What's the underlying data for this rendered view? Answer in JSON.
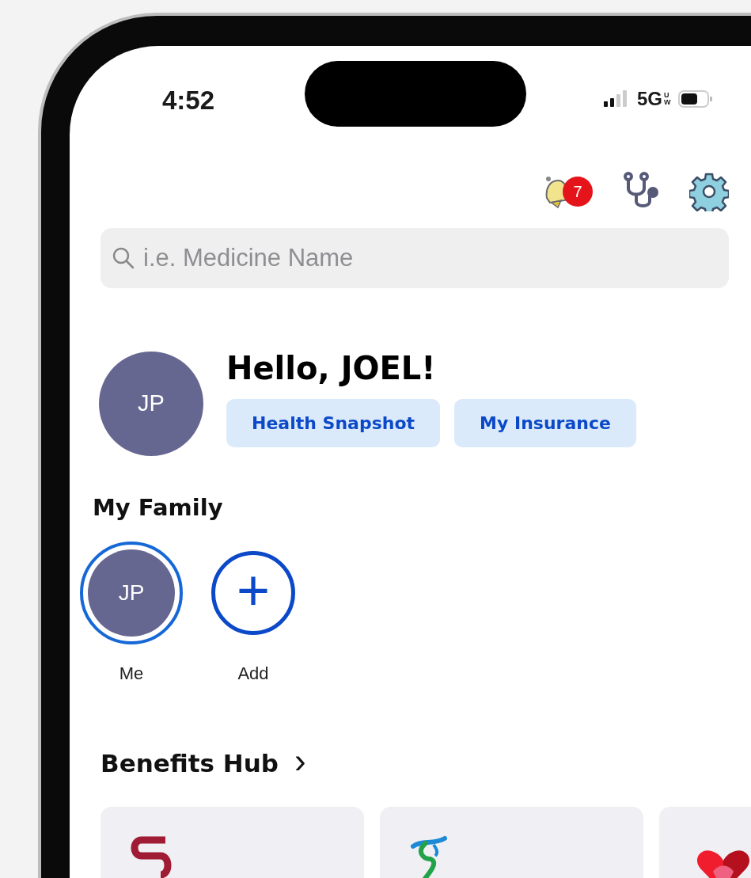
{
  "status_bar": {
    "time": "4:52",
    "network": "5G",
    "network_badge": "UW"
  },
  "header": {
    "notification_count": "7"
  },
  "search": {
    "placeholder": "i.e. Medicine Name"
  },
  "profile": {
    "initials": "JP",
    "greeting": "Hello, JOEL!"
  },
  "quick_buttons": [
    "Health Snapshot",
    "My Insurance"
  ],
  "family": {
    "title": "My Family",
    "members": [
      {
        "kind": "member",
        "initials": "JP",
        "label": "Me",
        "selected": true
      },
      {
        "kind": "add",
        "icon": "+",
        "label": "Add",
        "selected": false
      }
    ]
  },
  "benefits": {
    "title": "Benefits Hub",
    "chevron": "›",
    "cards": [
      {
        "kind": "ribbon"
      },
      {
        "kind": "script"
      },
      {
        "kind": "heart"
      }
    ]
  }
}
